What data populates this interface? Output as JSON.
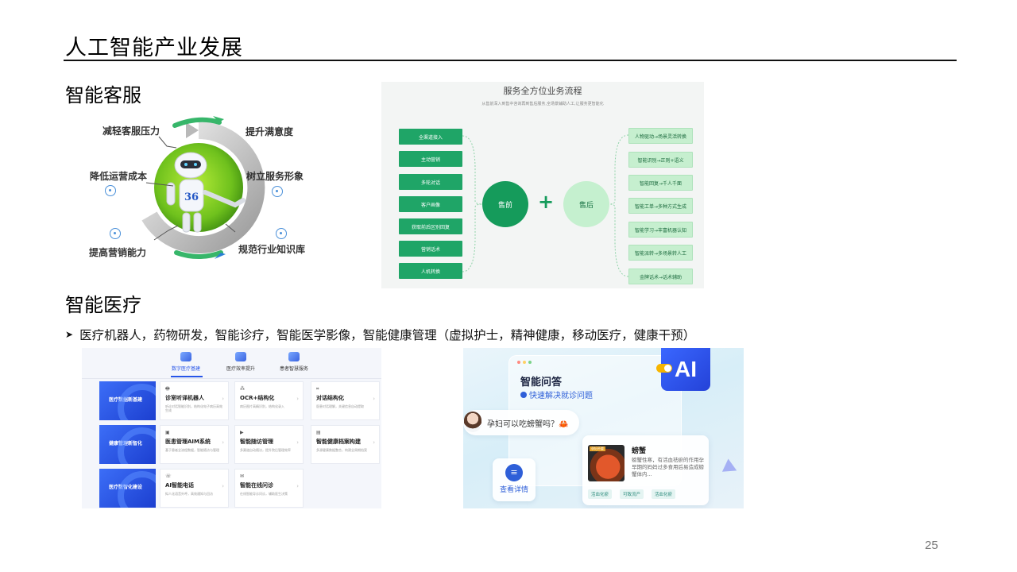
{
  "slide": {
    "title": "人工智能产业发展",
    "page_number": "25"
  },
  "section_customer_service": {
    "heading": "智能客服",
    "wheel": {
      "labels": [
        "减轻客服压力",
        "提升满意度",
        "降低运营成本",
        "树立服务形象",
        "提高营销能力",
        "规范行业知识库"
      ],
      "robot_chest_text": "36"
    },
    "flow": {
      "title": "服务全方位业务流程",
      "subtitle": "从售前深入到售中咨询再到售后服务,全场景辅助人工,让服务更智能化",
      "pre_sale_label": "售前",
      "after_sale_label": "售后",
      "plus": "+",
      "pre_sale_items": [
        "全渠道接入",
        "主动营销",
        "多轮对话",
        "客户画像",
        "获取前后区别回复",
        "营销话术",
        "人机转换"
      ],
      "after_sale_items": [
        "人物驱动→场景灵活转换",
        "智能识别→正则+语义",
        "智能回复→千人千面",
        "智能工单→多种方式生成",
        "智能学习→丰富机器认知",
        "智能派转→多场景转人工",
        "金牌话术→话术辅助"
      ]
    }
  },
  "section_medical": {
    "heading": "智能医疗",
    "bullet": "医疗机器人，药物研发，智能诊疗，智能医学影像，智能健康管理（虚拟护士，精神健康，移动医疗，健康干预）",
    "platform": {
      "tabs": [
        "数字医疗基建",
        "医疗效率提升",
        "患者智慧服务"
      ],
      "active_tab": 0,
      "categories": [
        "医疗数据新基建",
        "健康管理新智化",
        "医疗数智化建设"
      ],
      "cards": [
        {
          "icon": "printer-icon",
          "title": "诊室听译机器人",
          "desc": "听诊对话智能识别，结构化电子病历高效生成"
        },
        {
          "icon": "network-icon",
          "title": "OCR+结构化",
          "desc": "病历图片高精识别，结构化录入"
        },
        {
          "icon": "crop-icon",
          "title": "对话结构化",
          "desc": "医患对话理解，关键信息自动提取"
        },
        {
          "icon": "monitor-icon",
          "title": "医患管理AIM系统",
          "desc": "基于患者全流程数据，智能随访与管理"
        },
        {
          "icon": "play-icon",
          "title": "智能随访管理",
          "desc": "多渠道自动随访，提升院后管理效率"
        },
        {
          "icon": "clipboard-icon",
          "title": "智能健康档案构建",
          "desc": "多源健康数据整合，构建全周期档案"
        },
        {
          "icon": "phone-icon",
          "title": "AI智能电话",
          "desc": "拟人化语音外呼，高效通知与回访"
        },
        {
          "icon": "chat-icon",
          "title": "智能在线问诊",
          "desc": "在线智能导诊问诊，辅助医生决策"
        }
      ]
    },
    "qa": {
      "title": "智能问答",
      "subtitle": "快速解决就诊问题",
      "badge": "AI",
      "question": "孕妇可以吃螃蟹吗？🦀",
      "detail_button": "查看详情",
      "card_title": "螃蟹",
      "card_desc": "螃蟹性寒，有活血祛瘀的作用孕早期的妈妈过多食用后易造成螃蟹体内...",
      "card_image_tag": "孕妇不要",
      "tags": [
        "活血化瘀",
        "可致流产",
        "活血化瘀"
      ]
    }
  },
  "colors": {
    "flow_green": "#1fa567",
    "flow_light_green": "#c6efcf",
    "med_blue": "#2755e8",
    "ai_blue": "#3a67ff"
  }
}
